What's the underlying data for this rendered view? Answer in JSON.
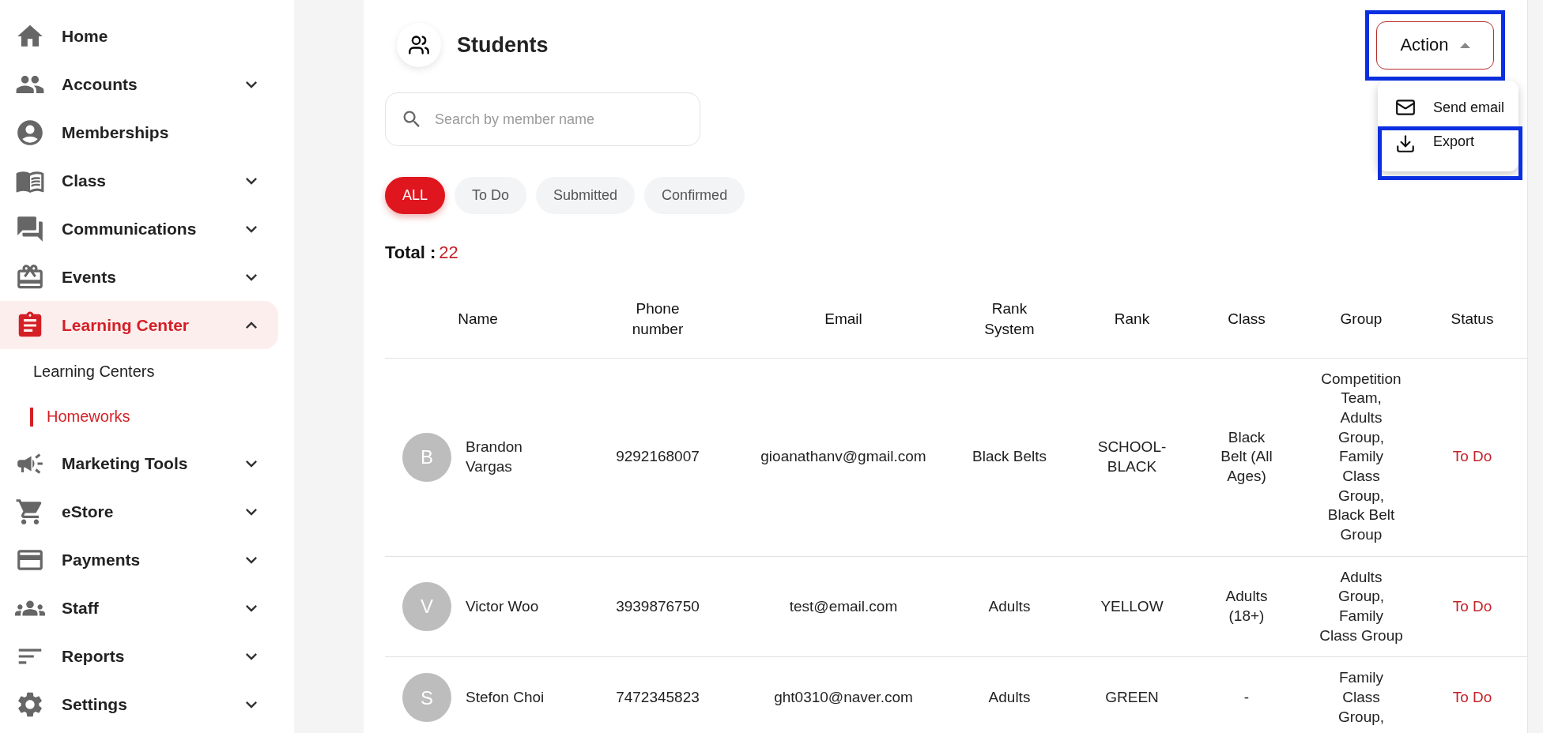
{
  "sidebar": {
    "items": [
      {
        "label": "Home",
        "kind": "link",
        "selected": false
      },
      {
        "label": "Accounts",
        "kind": "group",
        "selected": false,
        "expanded": false
      },
      {
        "label": "Memberships",
        "kind": "link",
        "selected": false
      },
      {
        "label": "Class",
        "kind": "group",
        "selected": false,
        "expanded": false
      },
      {
        "label": "Communications",
        "kind": "group",
        "selected": false,
        "expanded": false
      },
      {
        "label": "Events",
        "kind": "group",
        "selected": false,
        "expanded": false
      },
      {
        "label": "Learning Center",
        "kind": "group",
        "selected": true,
        "expanded": true,
        "children": [
          {
            "label": "Learning Centers",
            "selected": false
          },
          {
            "label": "Homeworks",
            "selected": true
          }
        ]
      },
      {
        "label": "Marketing Tools",
        "kind": "group",
        "selected": false,
        "expanded": false
      },
      {
        "label": "eStore",
        "kind": "group",
        "selected": false,
        "expanded": false
      },
      {
        "label": "Payments",
        "kind": "group",
        "selected": false,
        "expanded": false
      },
      {
        "label": "Staff",
        "kind": "group",
        "selected": false,
        "expanded": false
      },
      {
        "label": "Reports",
        "kind": "group",
        "selected": false,
        "expanded": false
      },
      {
        "label": "Settings",
        "kind": "group",
        "selected": false,
        "expanded": false
      }
    ]
  },
  "page": {
    "title": "Students",
    "action": {
      "label": "Action",
      "expanded": true,
      "annotated": true,
      "menu": [
        {
          "label": "Send email",
          "annotated": false
        },
        {
          "label": "Export",
          "annotated": true
        }
      ]
    },
    "search": {
      "placeholder": "Search by member name"
    },
    "filters": [
      {
        "label": "ALL",
        "selected": true
      },
      {
        "label": "To Do",
        "selected": false
      },
      {
        "label": "Submitted",
        "selected": false
      },
      {
        "label": "Confirmed",
        "selected": false
      }
    ],
    "total": {
      "label": "Total :",
      "value": "22"
    }
  },
  "table": {
    "columns": [
      "Name",
      "Phone number",
      "Email",
      "Rank System",
      "Rank",
      "Class",
      "Group",
      "Status"
    ],
    "rows": [
      {
        "initial": "B",
        "name": "Brandon Vargas",
        "phone": "9292168007",
        "email": "gioanathanv@gmail.com",
        "rank_system": "Black Belts",
        "rank": "SCHOOL-BLACK",
        "class": "Black Belt (All Ages)",
        "group": "Competition Team, Adults Group, Family Class Group, Black Belt Group",
        "status": "To Do"
      },
      {
        "initial": "V",
        "name": "Victor Woo",
        "phone": "3939876750",
        "email": "test@email.com",
        "rank_system": "Adults",
        "rank": "YELLOW",
        "class": "Adults (18+)",
        "group": "Adults Group, Family Class Group",
        "status": "To Do"
      },
      {
        "initial": "S",
        "name": "Stefon Choi",
        "phone": "7472345823",
        "email": "ght0310@naver.com",
        "rank_system": "Adults",
        "rank": "GREEN",
        "class": "-",
        "group": "Family Class Group,",
        "status": "To Do"
      }
    ]
  }
}
